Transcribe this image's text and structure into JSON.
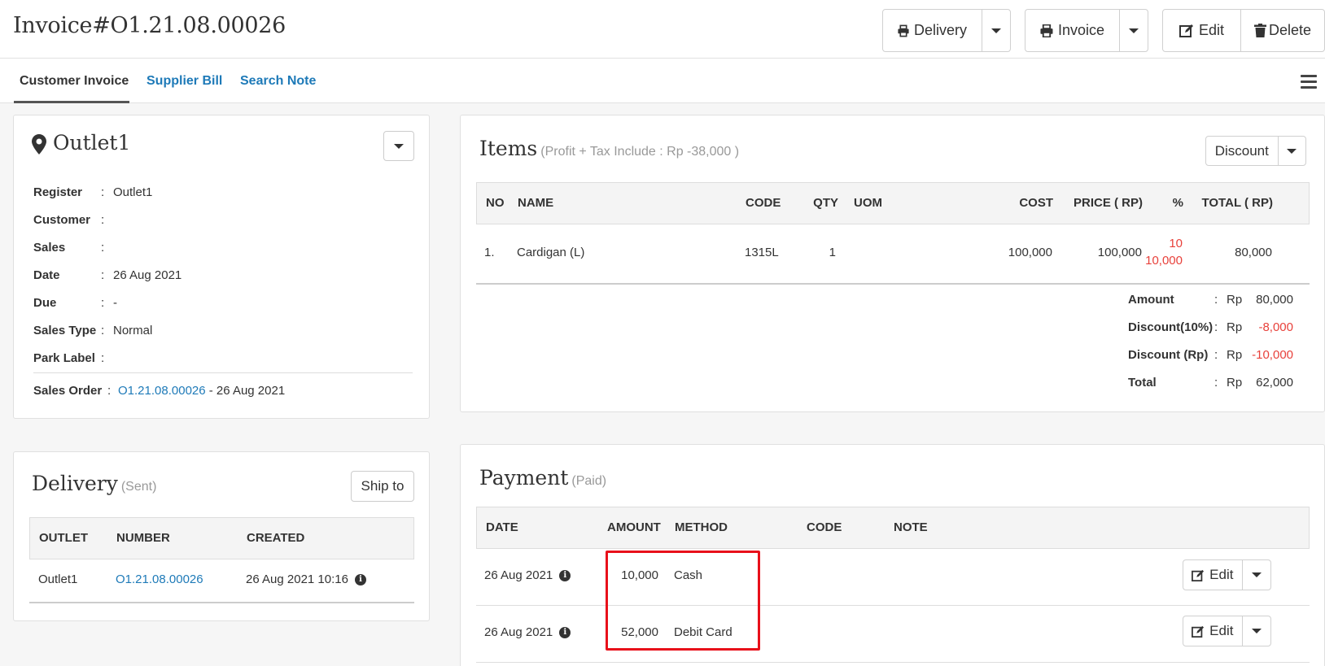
{
  "header": {
    "title": "Invoice#O1.21.08.00026",
    "delivery_label": "Delivery",
    "invoice_label": "Invoice",
    "edit_label": "Edit",
    "delete_label": "Delete"
  },
  "tabs": [
    {
      "label": "Customer Invoice"
    },
    {
      "label": "Supplier Bill"
    },
    {
      "label": "Search Note"
    }
  ],
  "outlet": {
    "title": "Outlet1",
    "rows": [
      {
        "label": "Register",
        "value": "Outlet1"
      },
      {
        "label": "Customer",
        "value": ""
      },
      {
        "label": "Sales",
        "value": ""
      },
      {
        "label": "Date",
        "value": "26 Aug 2021"
      },
      {
        "label": "Due",
        "value": "-"
      },
      {
        "label": "Sales Type",
        "value": "Normal"
      },
      {
        "label": "Park Label",
        "value": ""
      }
    ],
    "sales_order": {
      "label": "Sales Order",
      "link": "O1.21.08.00026",
      "date": "- 26 Aug 2021"
    }
  },
  "items": {
    "title": "Items",
    "subtitle": "(Profit + Tax Include : Rp -38,000 )",
    "discount_label": "Discount",
    "columns": [
      "NO",
      "NAME",
      "CODE",
      "QTY",
      "UOM",
      "COST",
      "PRICE ( RP)",
      "%",
      "TOTAL ( RP)"
    ],
    "rows": [
      {
        "no": "1.",
        "name": "Cardigan (L)",
        "code": "1315L",
        "qty": "1",
        "uom": "",
        "cost": "100,000",
        "price": "100,000",
        "pct": "10",
        "pct_amount": "10,000",
        "total": "80,000"
      }
    ],
    "summary": [
      {
        "label": "Amount",
        "colon": ":",
        "cur": "Rp",
        "value": "80,000",
        "red": false
      },
      {
        "label": "Discount(10%)",
        "colon": ":",
        "cur": "Rp",
        "value": "-8,000",
        "red": true
      },
      {
        "label": "Discount (Rp)",
        "colon": ":",
        "cur": "Rp",
        "value": "-10,000",
        "red": true
      },
      {
        "label": "Total",
        "colon": ":",
        "cur": "Rp",
        "value": "62,000",
        "red": false
      }
    ]
  },
  "delivery": {
    "title": "Delivery",
    "status": "(Sent)",
    "ship_label": "Ship to",
    "columns": [
      "OUTLET",
      "NUMBER",
      "CREATED"
    ],
    "rows": [
      {
        "outlet": "Outlet1",
        "number": "O1.21.08.00026",
        "created": "26 Aug 2021 10:16"
      }
    ]
  },
  "payment": {
    "title": "Payment",
    "status": "(Paid)",
    "columns": [
      "DATE",
      "AMOUNT",
      "METHOD",
      "CODE",
      "NOTE"
    ],
    "rows": [
      {
        "date": "26 Aug 2021",
        "amount": "10,000",
        "method": "Cash",
        "code": "",
        "note": "",
        "edit_label": "Edit"
      },
      {
        "date": "26 Aug 2021",
        "amount": "52,000",
        "method": "Debit Card",
        "code": "",
        "note": "",
        "edit_label": "Edit"
      }
    ]
  },
  "colors": {
    "link": "#1e7ab8",
    "negative": "#e8413b",
    "highlight": "#e8101a"
  }
}
